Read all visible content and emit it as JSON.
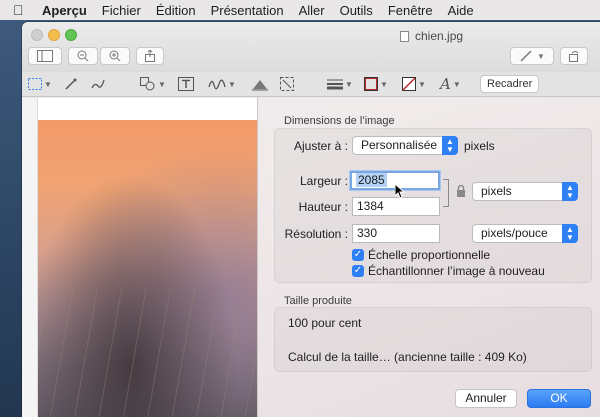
{
  "menubar": {
    "items": [
      "Aperçu",
      "Fichier",
      "Édition",
      "Présentation",
      "Aller",
      "Outils",
      "Fenêtre",
      "Aide"
    ]
  },
  "window": {
    "title": "chien.jpg",
    "toolbar": {
      "crop_label": "Recadrer"
    }
  },
  "dialog": {
    "section_dimensions": "Dimensions de l’image",
    "fit_label": "Ajuster à :",
    "fit_value": "Personnalisée",
    "fit_unit": "pixels",
    "width_label": "Largeur :",
    "width_value": "2085",
    "height_label": "Hauteur :",
    "height_value": "1384",
    "size_unit_value": "pixels",
    "resolution_label": "Résolution :",
    "resolution_value": "330",
    "resolution_unit_value": "pixels/pouce",
    "scale_proportionally_label": "Échelle proportionnelle",
    "resample_label": "Échantillonner l’image à nouveau",
    "section_result": "Taille produite",
    "result_percent": "100 pour cent",
    "result_size": "Calcul de la taille… (ancienne taille : 409 Ko)",
    "cancel_label": "Annuler",
    "ok_label": "OK"
  },
  "colors": {
    "accent": "#2f7ff7"
  }
}
